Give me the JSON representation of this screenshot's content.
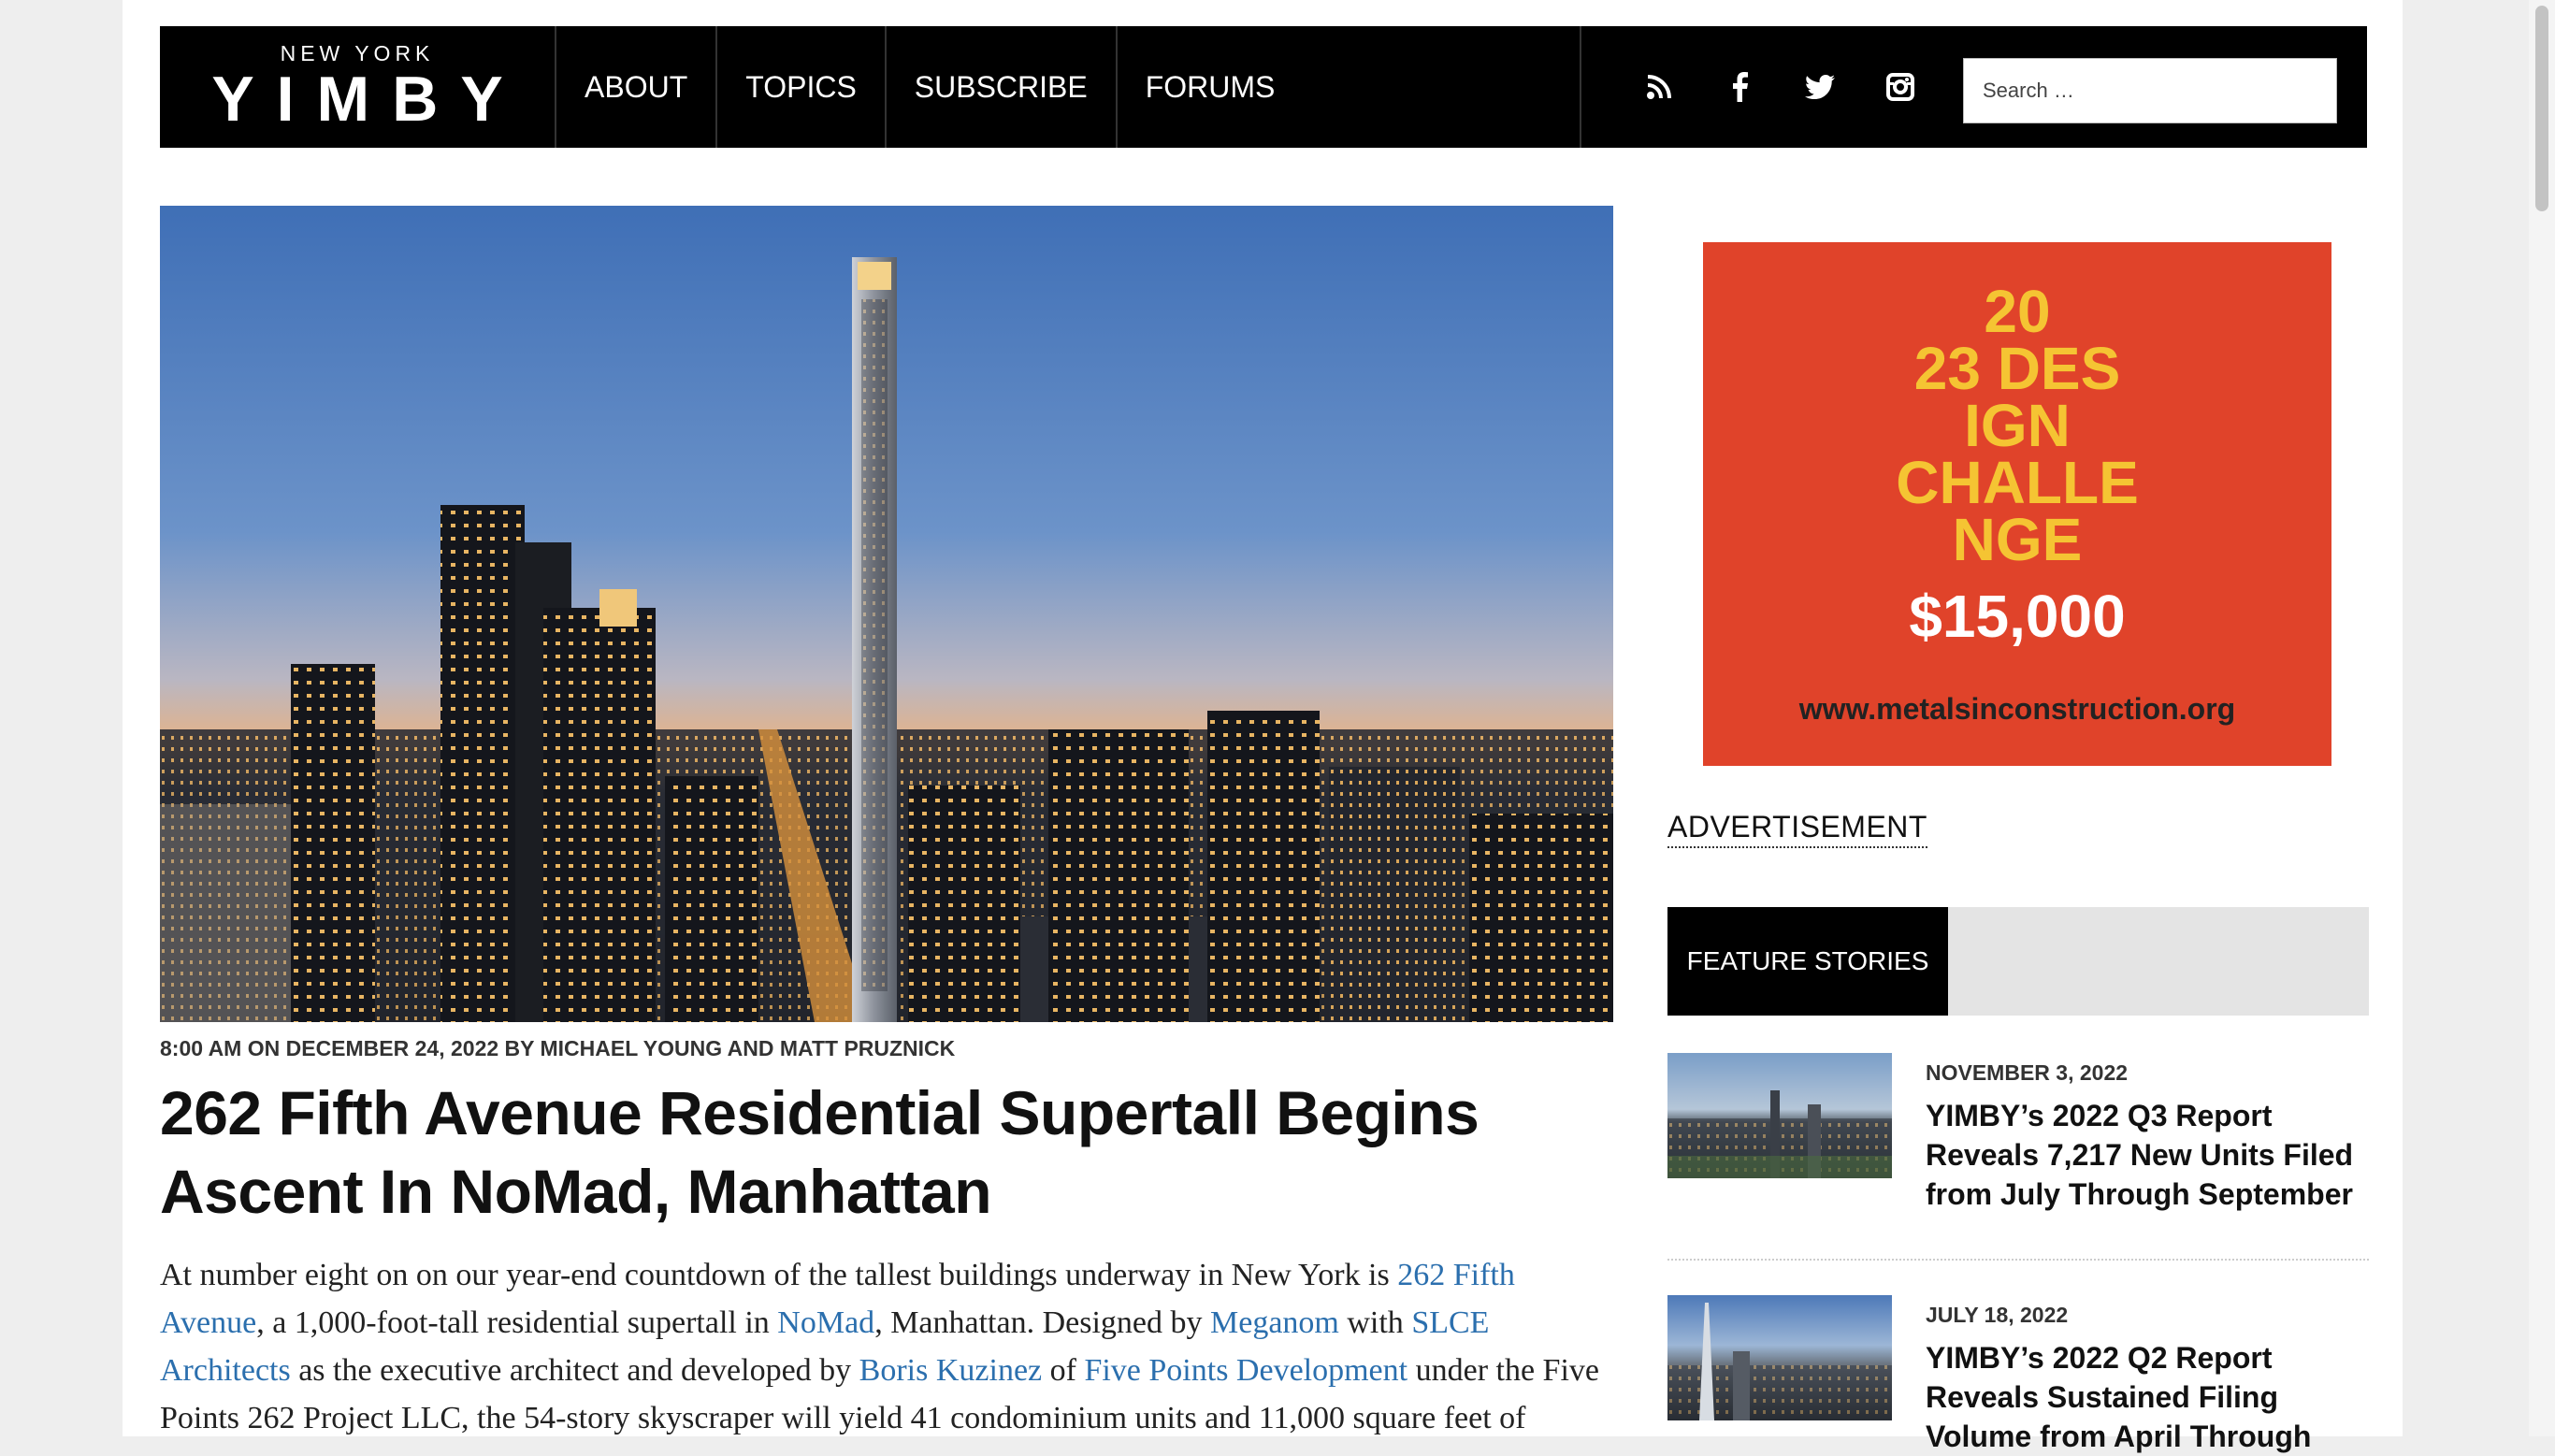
{
  "header": {
    "logo_small": "NEW YORK",
    "logo_big": "YIMBY",
    "nav": [
      "ABOUT",
      "TOPICS",
      "SUBSCRIBE",
      "FORUMS"
    ],
    "social_icons": [
      "rss-icon",
      "facebook-icon",
      "twitter-icon",
      "instagram-icon"
    ],
    "search_placeholder": "Search …"
  },
  "article": {
    "meta": "8:00 AM ON DECEMBER 24, 2022 BY MICHAEL YOUNG AND MATT PRUZNICK",
    "title": "262 Fifth Avenue Residential Supertall Begins Ascent In NoMad, Manhattan",
    "body": [
      {
        "t": "At number eight on on our year-end countdown of the tallest buildings underway in New York is "
      },
      {
        "t": "262 Fifth Avenue",
        "link": true
      },
      {
        "t": ", a 1,000-foot-tall residential supertall in "
      },
      {
        "t": "NoMad",
        "link": true
      },
      {
        "t": ", Manhattan. Designed by "
      },
      {
        "t": "Meganom",
        "link": true
      },
      {
        "t": " with "
      },
      {
        "t": "SLCE Architects",
        "link": true
      },
      {
        "t": " as the executive architect and developed by "
      },
      {
        "t": "Boris Kuzinez",
        "link": true
      },
      {
        "t": " of "
      },
      {
        "t": "Five Points Development",
        "link": true
      },
      {
        "t": " under the Five Points 262 Project LLC, the 54-story skyscraper will yield 41 condominium units and 11,000 square feet of"
      }
    ]
  },
  "sidebar": {
    "ad": {
      "lines": [
        "20",
        "23 DES",
        "IGN",
        "CHALLE",
        "NGE"
      ],
      "price": "$15,000",
      "url": "www.metalsinconstruction.org"
    },
    "ad_label": "ADVERTISEMENT",
    "feature_tab": "FEATURE STORIES",
    "stories": [
      {
        "date": "NOVEMBER 3, 2022",
        "title": "YIMBY’s 2022 Q3 Report Reveals 7,217 New Units Filed from July Through September"
      },
      {
        "date": "JULY 18, 2022",
        "title": "YIMBY’s 2022 Q2 Report Reveals Sustained Filing Volume from April Through"
      }
    ]
  },
  "colors": {
    "header_bg": "#000000",
    "link": "#2b6fae",
    "ad_bg": "#e0432a",
    "ad_text": "#f5c433"
  }
}
